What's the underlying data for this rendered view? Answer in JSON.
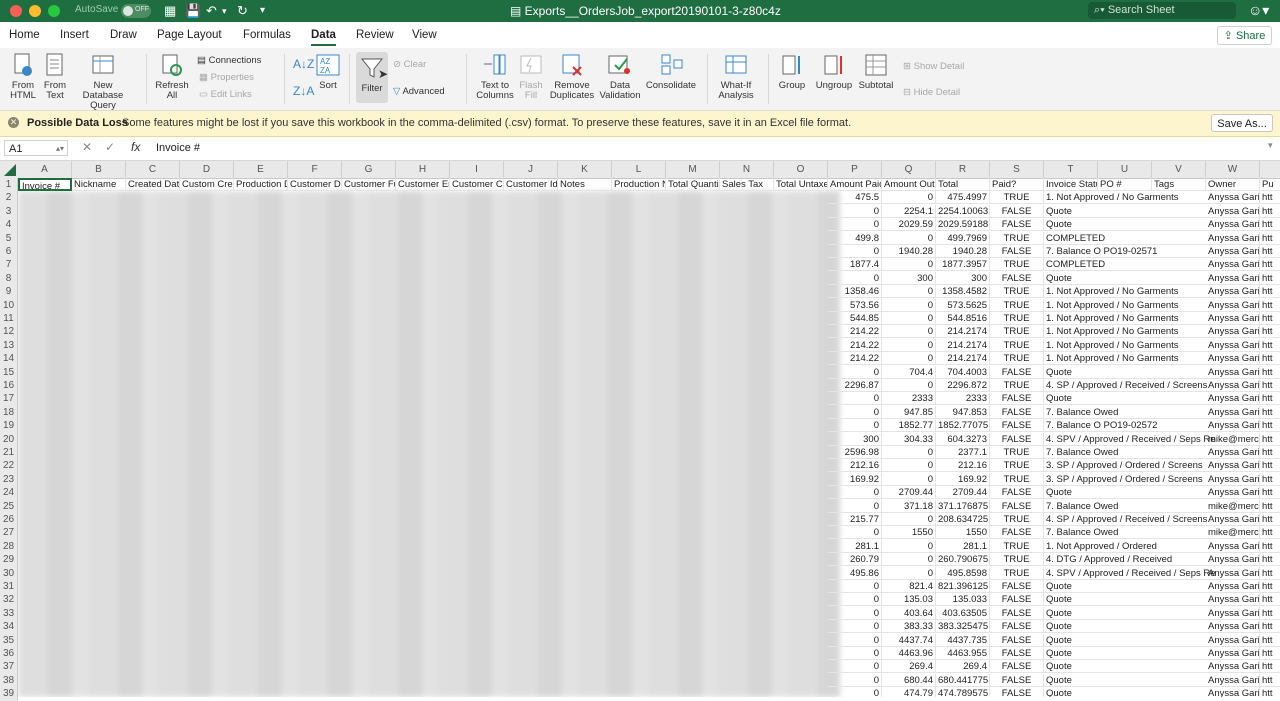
{
  "window": {
    "title": "Exports__OrdersJob_export20190101-3-z80c4z",
    "autosave_label": "AutoSave",
    "autosave_state": "OFF",
    "search_placeholder": "Search Sheet"
  },
  "colors": {
    "brand": "#1e6e42",
    "close": "#fe5f57",
    "minimize": "#febc2e",
    "zoom": "#28c840",
    "banner": "#fcf5cd"
  },
  "tabs": [
    {
      "label": "Home"
    },
    {
      "label": "Insert"
    },
    {
      "label": "Draw"
    },
    {
      "label": "Page Layout"
    },
    {
      "label": "Formulas"
    },
    {
      "label": "Data"
    },
    {
      "label": "Review"
    },
    {
      "label": "View"
    }
  ],
  "share_label": "Share",
  "ribbon": {
    "from_html": "From HTML",
    "from_text": "From Text",
    "new_db_query": "New Database Query",
    "refresh_all": "Refresh All",
    "connections": "Connections",
    "properties": "Properties",
    "edit_links": "Edit Links",
    "sort": "Sort",
    "filter": "Filter",
    "clear": "Clear",
    "advanced": "Advanced",
    "text_to_columns": "Text to Columns",
    "flash_fill": "Flash Fill",
    "remove_duplicates": "Remove Duplicates",
    "data_validation": "Data Validation",
    "consolidate": "Consolidate",
    "what_if": "What-If Analysis",
    "group": "Group",
    "ungroup": "Ungroup",
    "subtotal": "Subtotal",
    "show_detail": "Show Detail",
    "hide_detail": "Hide Detail"
  },
  "banner": {
    "title": "Possible Data Loss",
    "text": "Some features might be lost if you save this workbook in the comma-delimited (.csv) format. To preserve these features, save it in an Excel file format.",
    "button": "Save As..."
  },
  "formula_bar": {
    "name_box": "A1",
    "fx": "fx",
    "value": "Invoice #"
  },
  "columns": [
    "A",
    "B",
    "C",
    "D",
    "E",
    "F",
    "G",
    "H",
    "I",
    "J",
    "K",
    "L",
    "M",
    "N",
    "O",
    "P",
    "Q",
    "R",
    "S",
    "T",
    "U",
    "V",
    "W",
    "X"
  ],
  "headers": [
    "Invoice #",
    "Nickname",
    "Created Date",
    "Custom Created",
    "Production D",
    "Customer Du",
    "Customer Fu",
    "Customer Em",
    "Customer Co",
    "Customer Id",
    "Notes",
    "Production N",
    "Total Quanti",
    "Sales Tax",
    "Total Untaxe",
    "Amount Paid",
    "Amount Outs",
    "Total",
    "Paid?",
    "Invoice Statu",
    "PO #",
    "Tags",
    "Owner",
    "Pu"
  ],
  "rows": [
    [
      "475.5",
      "0",
      "475.4997",
      "TRUE",
      "1. Not Approved / No Garments",
      "Anyssa Garit",
      "htt"
    ],
    [
      "0",
      "2254.1",
      "2254.10063",
      "FALSE",
      "Quote",
      "Anyssa Garit",
      "htt"
    ],
    [
      "0",
      "2029.59",
      "2029.59188",
      "FALSE",
      "Quote",
      "Anyssa Garit",
      "htt"
    ],
    [
      "499.8",
      "0",
      "499.7969",
      "TRUE",
      "COMPLETED",
      "Anyssa Garit",
      "htt"
    ],
    [
      "0",
      "1940.28",
      "1940.28",
      "FALSE",
      "7. Balance O PO19-02571",
      "Anyssa Garit",
      "htt"
    ],
    [
      "1877.4",
      "0",
      "1877.3957",
      "TRUE",
      "COMPLETED",
      "Anyssa Garit",
      "htt"
    ],
    [
      "0",
      "300",
      "300",
      "FALSE",
      "Quote",
      "Anyssa Garit",
      "htt"
    ],
    [
      "1358.46",
      "0",
      "1358.4582",
      "TRUE",
      "1. Not Approved / No Garments",
      "Anyssa Garit",
      "htt"
    ],
    [
      "573.56",
      "0",
      "573.5625",
      "TRUE",
      "1. Not Approved / No Garments",
      "Anyssa Garit",
      "htt"
    ],
    [
      "544.85",
      "0",
      "544.8516",
      "TRUE",
      "1. Not Approved / No Garments",
      "Anyssa Garit",
      "htt"
    ],
    [
      "214.22",
      "0",
      "214.2174",
      "TRUE",
      "1. Not Approved / No Garments",
      "Anyssa Garit",
      "htt"
    ],
    [
      "214.22",
      "0",
      "214.2174",
      "TRUE",
      "1. Not Approved / No Garments",
      "Anyssa Garit",
      "htt"
    ],
    [
      "214.22",
      "0",
      "214.2174",
      "TRUE",
      "1. Not Approved / No Garments",
      "Anyssa Garit",
      "htt"
    ],
    [
      "0",
      "704.4",
      "704.4003",
      "FALSE",
      "Quote",
      "Anyssa Garit",
      "htt"
    ],
    [
      "2296.87",
      "0",
      "2296.872",
      "TRUE",
      "4. SP / Approved / Received / Screens",
      "Anyssa Garit",
      "htt"
    ],
    [
      "0",
      "2333",
      "2333",
      "FALSE",
      "Quote",
      "Anyssa Garit",
      "htt"
    ],
    [
      "0",
      "947.85",
      "947.853",
      "FALSE",
      "7. Balance Owed",
      "Anyssa Garit",
      "htt"
    ],
    [
      "0",
      "1852.77",
      "1852.77075",
      "FALSE",
      "7. Balance O PO19-02572",
      "Anyssa Garit",
      "htt"
    ],
    [
      "300",
      "304.33",
      "604.3273",
      "FALSE",
      "4. SPV / Approved / Received / Seps Re",
      "mike@merch",
      "htt"
    ],
    [
      "2596.98",
      "0",
      "2377.1",
      "TRUE",
      "7. Balance Owed",
      "Anyssa Garit",
      "htt"
    ],
    [
      "212.16",
      "0",
      "212.16",
      "TRUE",
      "3. SP / Approved / Ordered / Screens",
      "Anyssa Garit",
      "htt"
    ],
    [
      "169.92",
      "0",
      "169.92",
      "TRUE",
      "3. SP / Approved / Ordered / Screens",
      "Anyssa Garit",
      "htt"
    ],
    [
      "0",
      "2709.44",
      "2709.44",
      "FALSE",
      "Quote",
      "Anyssa Garit",
      "htt"
    ],
    [
      "0",
      "371.18",
      "371.176875",
      "FALSE",
      "7. Balance Owed",
      "mike@merch",
      "htt"
    ],
    [
      "215.77",
      "0",
      "208.634725",
      "TRUE",
      "4. SP / Approved / Received / Screens",
      "Anyssa Garit",
      "htt"
    ],
    [
      "0",
      "1550",
      "1550",
      "FALSE",
      "7. Balance Owed",
      "mike@merch",
      "htt"
    ],
    [
      "281.1",
      "0",
      "281.1",
      "TRUE",
      "1. Not Approved / Ordered",
      "Anyssa Garit",
      "htt"
    ],
    [
      "260.79",
      "0",
      "260.790675",
      "TRUE",
      "4. DTG / Approved / Received",
      "Anyssa Garit",
      "htt"
    ],
    [
      "495.86",
      "0",
      "495.8598",
      "TRUE",
      "4. SPV / Approved / Received / Seps Re",
      "Anyssa Garit",
      "htt"
    ],
    [
      "0",
      "821.4",
      "821.396125",
      "FALSE",
      "Quote",
      "Anyssa Garit",
      "htt"
    ],
    [
      "0",
      "135.03",
      "135.033",
      "FALSE",
      "Quote",
      "Anyssa Garit",
      "htt"
    ],
    [
      "0",
      "403.64",
      "403.63505",
      "FALSE",
      "Quote",
      "Anyssa Garit",
      "htt"
    ],
    [
      "0",
      "383.33",
      "383.325475",
      "FALSE",
      "Quote",
      "Anyssa Garit",
      "htt"
    ],
    [
      "0",
      "4437.74",
      "4437.735",
      "FALSE",
      "Quote",
      "Anyssa Garit",
      "htt"
    ],
    [
      "0",
      "4463.96",
      "4463.955",
      "FALSE",
      "Quote",
      "Anyssa Garit",
      "htt"
    ],
    [
      "0",
      "269.4",
      "269.4",
      "FALSE",
      "Quote",
      "Anyssa Garit",
      "htt"
    ],
    [
      "0",
      "680.44",
      "680.441775",
      "FALSE",
      "Quote",
      "Anyssa Garit",
      "htt"
    ],
    [
      "0",
      "474.79",
      "474.789575",
      "FALSE",
      "Quote",
      "Anyssa Garit",
      "htt"
    ]
  ]
}
